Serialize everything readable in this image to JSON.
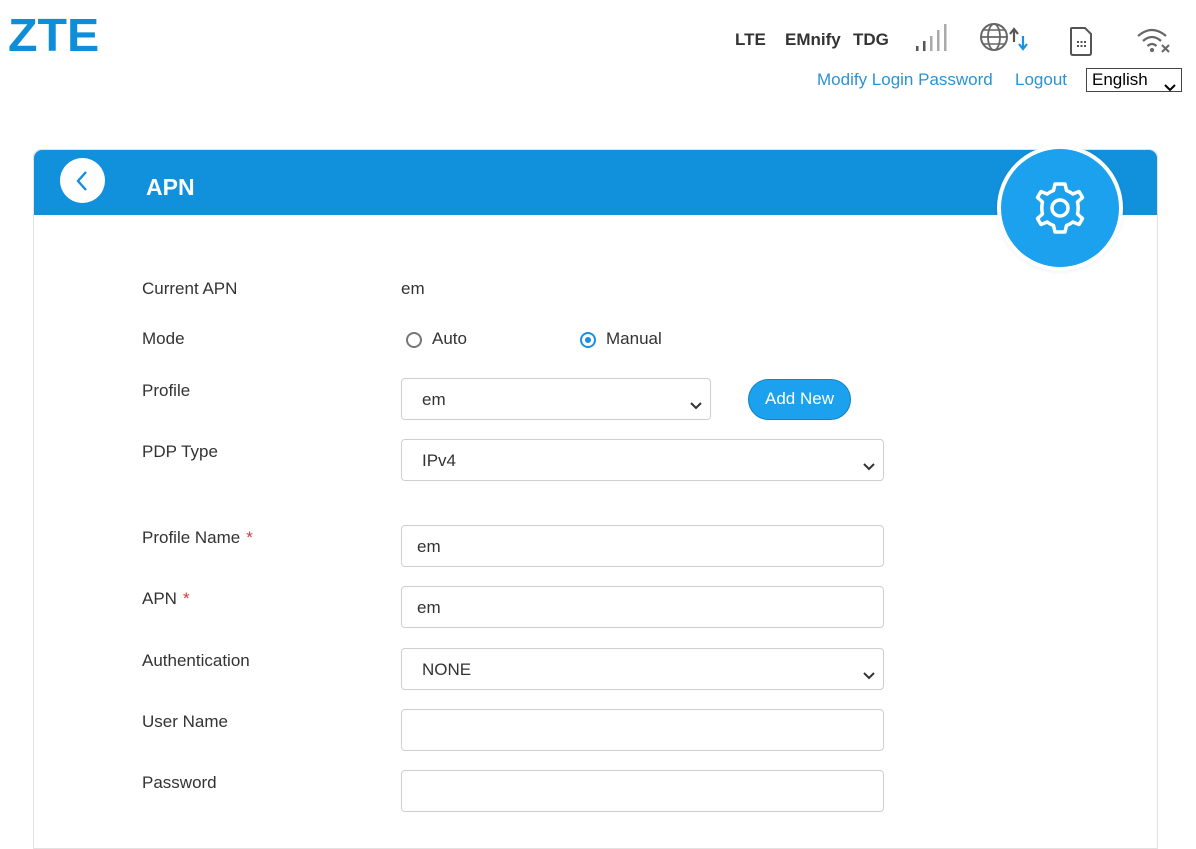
{
  "brand": {
    "logo": "ZTE",
    "accent": "#1190dc"
  },
  "status": {
    "network": "LTE",
    "operator": "EMnify",
    "carrier": "TDG",
    "icons": [
      "signal-bars-icon",
      "globe-data-icon",
      "sim-card-icon",
      "wifi-off-icon"
    ]
  },
  "toplinks": {
    "modify_password": "Modify Login Password",
    "logout": "Logout",
    "language": "English"
  },
  "panel": {
    "title": "APN"
  },
  "form": {
    "current_apn_label": "Current APN",
    "current_apn_value": "em",
    "mode_label": "Mode",
    "mode_options": [
      "Auto",
      "Manual"
    ],
    "mode_selected": "Manual",
    "profile_label": "Profile",
    "profile_value": "em",
    "add_new_label": "Add New",
    "pdp_type_label": "PDP Type",
    "pdp_type_value": "IPv4",
    "profile_name_label": "Profile Name",
    "profile_name_value": "em",
    "apn_label": "APN",
    "apn_value": "em",
    "required_mark": "*",
    "auth_label": "Authentication",
    "auth_value": "NONE",
    "username_label": "User Name",
    "username_value": "",
    "password_label": "Password",
    "password_value": ""
  }
}
